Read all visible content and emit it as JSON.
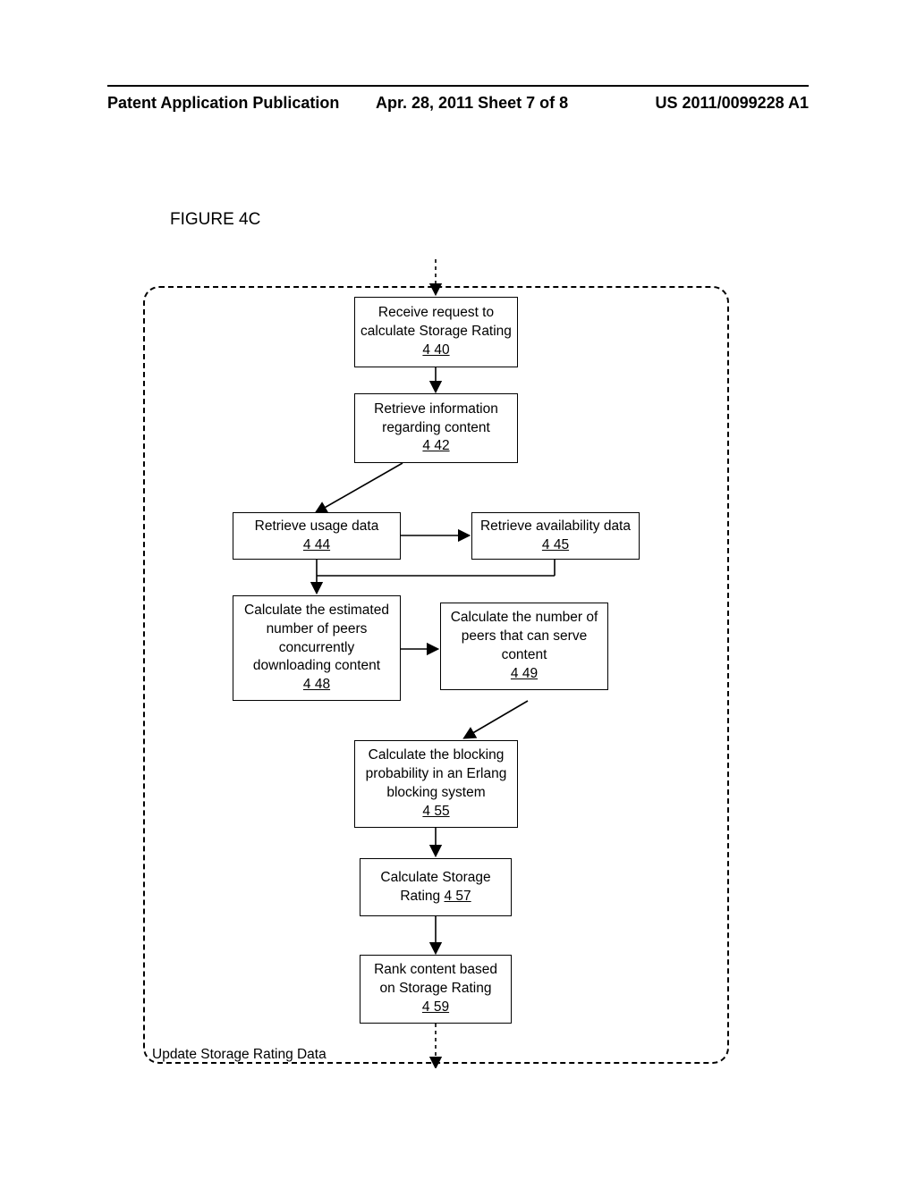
{
  "header": {
    "left": "Patent Application Publication",
    "mid": "Apr. 28, 2011  Sheet 7 of 8",
    "right": "US 2011/0099228 A1"
  },
  "figure_label": "FIGURE 4C",
  "boxes": {
    "b440": {
      "text": "Receive request to calculate Storage Rating",
      "ref": "4 40"
    },
    "b442": {
      "text": "Retrieve information regarding content",
      "ref": "4 42"
    },
    "b444": {
      "text": "Retrieve usage data",
      "ref": "4 44"
    },
    "b445": {
      "text": "Retrieve availability data",
      "ref": "4 45"
    },
    "b448": {
      "text": "Calculate the estimated number of peers concurrently downloading content",
      "ref": "4 48"
    },
    "b449": {
      "text": "Calculate the number of peers that can serve content",
      "ref": "4 49"
    },
    "b455": {
      "text": "Calculate the blocking probability in an Erlang blocking system",
      "ref": "4 55"
    },
    "b457": {
      "text": "Calculate Storage Rating ",
      "ref": "4 57"
    },
    "b459": {
      "text": "Rank content based on Storage Rating",
      "ref": "4 59"
    }
  },
  "group_label": "Update Storage Rating Data"
}
